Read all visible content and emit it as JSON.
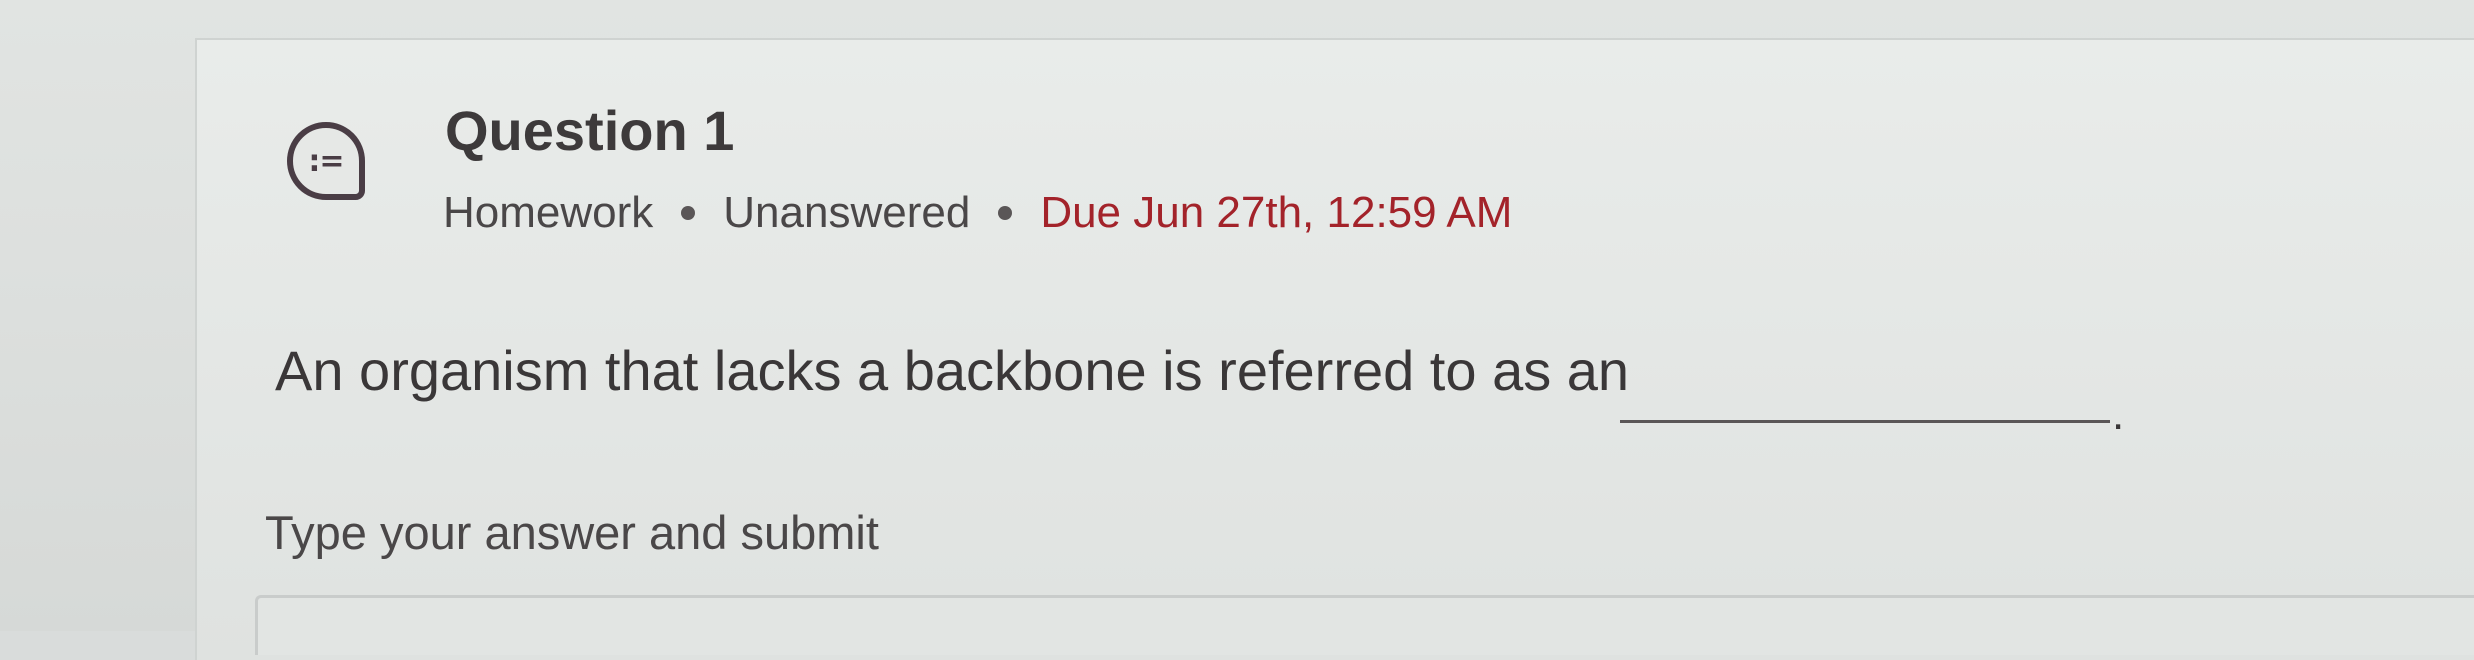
{
  "question": {
    "icon": "short-answer-icon",
    "icon_glyph": ":=",
    "title": "Question 1",
    "type": "Homework",
    "status": "Unanswered",
    "due": "Due Jun 27th, 12:59 AM",
    "text": "An organism that lacks a backbone is referred to as an",
    "text_end": ".",
    "prompt": "Type your answer and submit"
  },
  "colors": {
    "due_text": "#a3232a",
    "icon": "#4a3d45"
  }
}
